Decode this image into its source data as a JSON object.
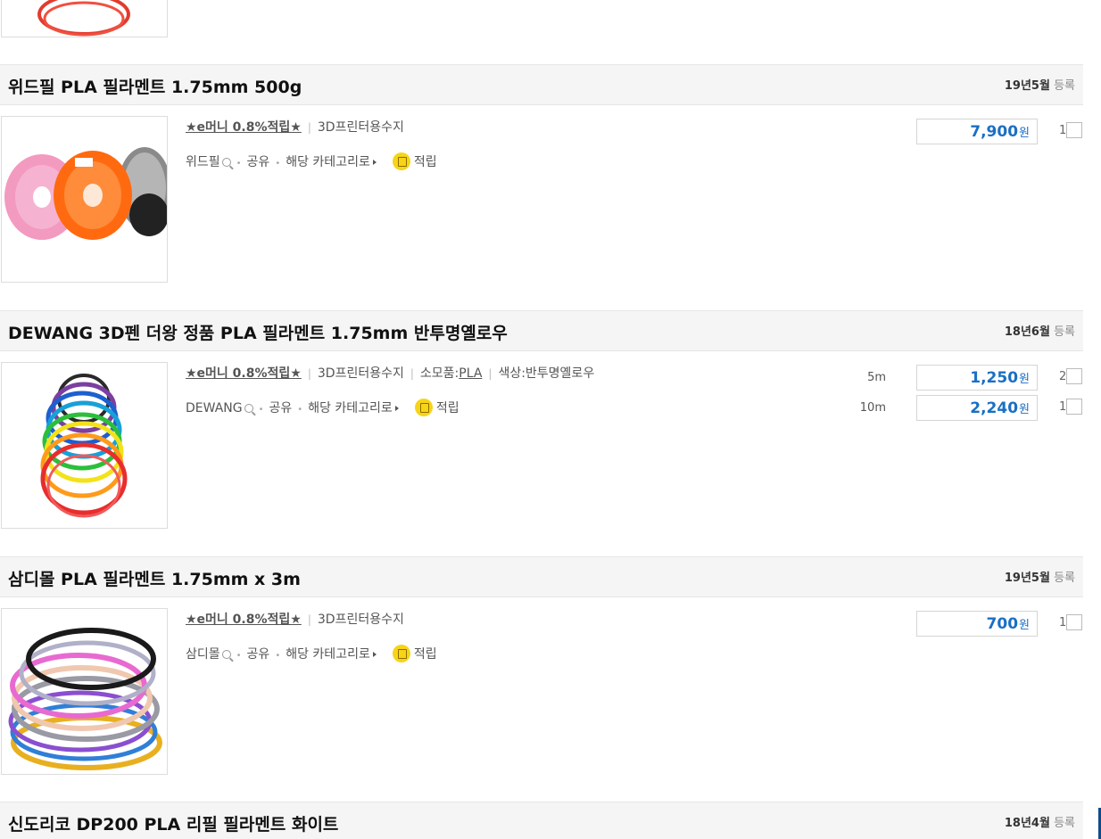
{
  "products": [
    {
      "title": "위드필 PLA 필라멘트 1.75mm 500g",
      "reg_ym": "19년5월",
      "reg_label": "등록",
      "emoney": "★e머니 0.8%적립★",
      "category": "3D프린터용수지",
      "brand": "위드필",
      "share": "공유",
      "cat_link": "해당 카테고리로",
      "reward": "적립",
      "options": [
        {
          "label": "",
          "price": "7,900",
          "unit": "원",
          "count": "1"
        }
      ]
    },
    {
      "title": "DEWANG 3D펜 더왕 정품 PLA 필라멘트 1.75mm 반투명옐로우",
      "reg_ym": "18년6월",
      "reg_label": "등록",
      "emoney": "★e머니 0.8%적립★",
      "category": "3D프린터용수지",
      "consumable_label": "소모품:",
      "consumable_value": "PLA",
      "color": "색상:반투명옐로우",
      "brand": "DEWANG",
      "share": "공유",
      "cat_link": "해당 카테고리로",
      "reward": "적립",
      "options": [
        {
          "label": "5m",
          "price": "1,250",
          "unit": "원",
          "count": "2"
        },
        {
          "label": "10m",
          "price": "2,240",
          "unit": "원",
          "count": "1"
        }
      ]
    },
    {
      "title": "삼디몰 PLA 필라멘트 1.75mm x 3m",
      "reg_ym": "19년5월",
      "reg_label": "등록",
      "emoney": "★e머니 0.8%적립★",
      "category": "3D프린터용수지",
      "brand": "삼디몰",
      "share": "공유",
      "cat_link": "해당 카테고리로",
      "reward": "적립",
      "options": [
        {
          "label": "",
          "price": "700",
          "unit": "원",
          "count": "1"
        }
      ]
    },
    {
      "title": "신도리코 DP200 PLA 리필 필라멘트 화이트",
      "reg_ym": "18년4월",
      "reg_label": "등록"
    }
  ],
  "colors": {
    "price": "#1a6fc4",
    "title_bar": "#f5f5f5",
    "coin": "#f7d416"
  }
}
